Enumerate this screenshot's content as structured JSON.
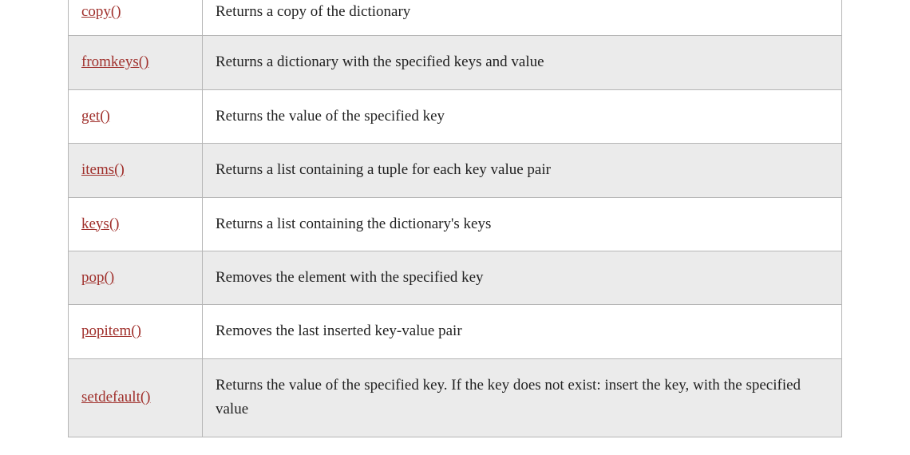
{
  "methods": [
    {
      "name": "copy()",
      "description": "Returns a copy of the dictionary",
      "alt": false
    },
    {
      "name": "fromkeys()",
      "description": "Returns a dictionary with the specified keys and value",
      "alt": true
    },
    {
      "name": "get()",
      "description": "Returns the value of the specified key",
      "alt": false
    },
    {
      "name": "items()",
      "description": "Returns a list containing a tuple for each key value pair",
      "alt": true
    },
    {
      "name": "keys()",
      "description": "Returns a list containing the dictionary's keys",
      "alt": false
    },
    {
      "name": "pop()",
      "description": "Removes the element with the specified key",
      "alt": true
    },
    {
      "name": "popitem()",
      "description": "Removes the last inserted key-value pair",
      "alt": false
    },
    {
      "name": "setdefault()",
      "description": "Returns the value of the specified key. If the key does not exist: insert the key, with the specified value",
      "alt": true
    }
  ]
}
